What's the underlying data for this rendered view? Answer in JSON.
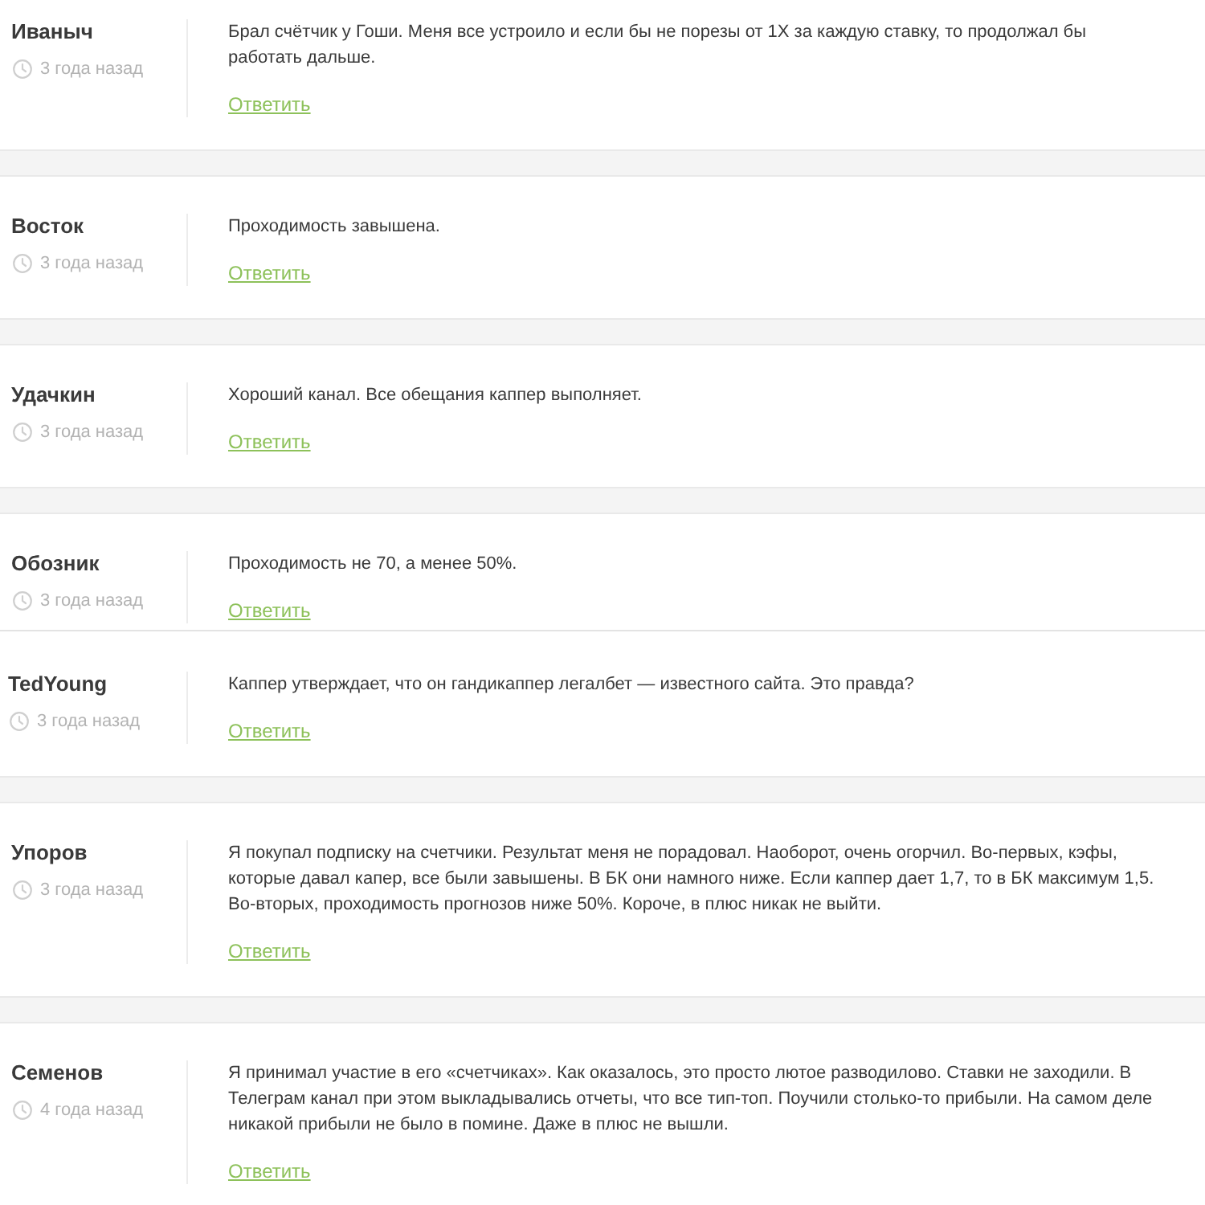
{
  "comments": [
    {
      "author": "Иваныч",
      "time": "3 года назад",
      "text": "Брал счётчик у Гоши. Меня все устроило и если бы не порезы от 1X за каждую ставку, то продолжал бы работать дальше.",
      "reply": "Ответить"
    },
    {
      "author": "Восток",
      "time": "3 года назад",
      "text": "Проходимость завышена.",
      "reply": "Ответить"
    },
    {
      "author": "Удачкин",
      "time": "3 года назад",
      "text": "Хороший канал. Все обещания каппер выполняет.",
      "reply": "Ответить"
    },
    {
      "author": "Обозник",
      "time": "3 года назад",
      "text": "Проходимость не 70, а менее 50%.",
      "reply": "Ответить"
    },
    {
      "author": "TedYoung",
      "time": "3 года назад",
      "text": "Каппер утверждает, что он гандикаппер легалбет — известного сайта. Это правда?",
      "reply": "Ответить"
    },
    {
      "author": "Упоров",
      "time": "3 года назад",
      "text": "Я покупал подписку на счетчики. Результат меня не порадовал. Наоборот, очень огорчил. Во-первых, кэфы, которые давал капер, все были завышены. В БК они намного ниже. Если каппер дает 1,7, то в БК максимум 1,5. Во-вторых, проходимость прогнозов ниже 50%. Короче, в плюс никак не выйти.",
      "reply": "Ответить"
    },
    {
      "author": "Семенов",
      "time": "4 года назад",
      "text": "Я принимал участие в его «счетчиках». Как оказалось, это просто лютое разводилово. Ставки не заходили. В Телеграм канал при этом выкладывались отчеты, что все тип-топ. Поучили столько-то прибыли. На самом деле никакой прибыли не было в помине. Даже в плюс не вышли.",
      "reply": "Ответить"
    }
  ]
}
